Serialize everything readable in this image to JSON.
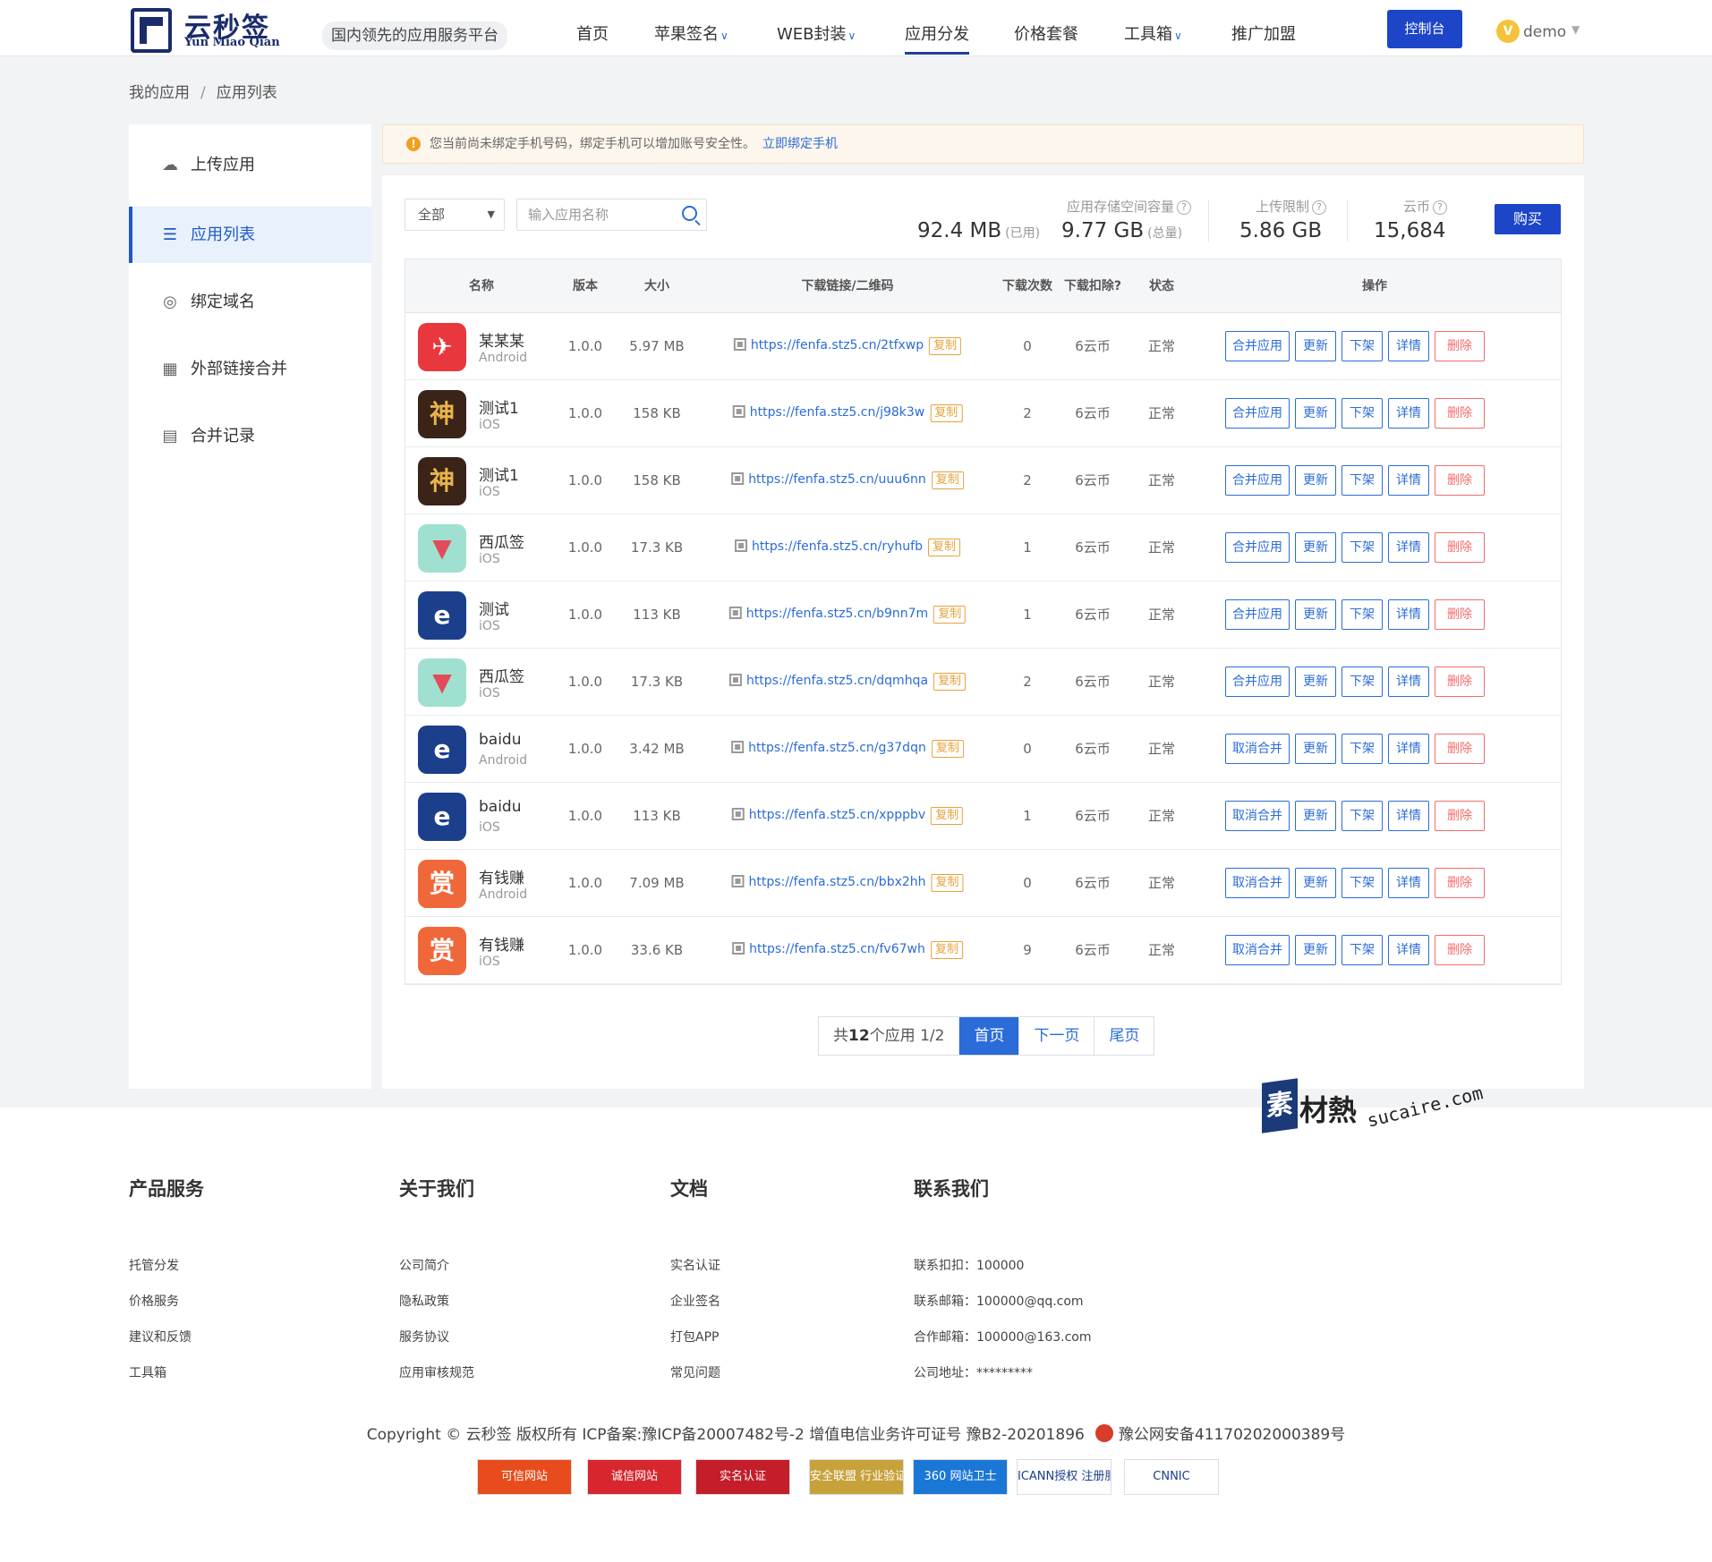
{
  "header": {
    "logo_cn": "云秒签",
    "logo_en": "Yun Miao Qian",
    "slogan": "国内领先的应用服务平台",
    "nav": [
      "首页",
      "苹果签名",
      "WEB封装",
      "应用分发",
      "价格套餐",
      "工具箱",
      "推广加盟"
    ],
    "console": "控制台",
    "user_initial": "V",
    "user": "demo"
  },
  "breadcrumb": [
    "我的应用",
    "应用列表"
  ],
  "sidebar": {
    "items": [
      {
        "icon": "cloud-upload-icon",
        "label": "上传应用"
      },
      {
        "icon": "list-icon",
        "label": "应用列表"
      },
      {
        "icon": "globe-icon",
        "label": "绑定域名"
      },
      {
        "icon": "qrcode-icon",
        "label": "外部链接合并"
      },
      {
        "icon": "clipboard-icon",
        "label": "合并记录"
      }
    ]
  },
  "notice": {
    "text": "您当前尚未绑定手机号码，绑定手机可以增加账号安全性。",
    "link": "立即绑定手机"
  },
  "filters": {
    "select_value": "全部",
    "search_placeholder": "输入应用名称"
  },
  "stats": {
    "storage_label": "应用存储空间容量",
    "used": "92.4 MB",
    "used_suffix": "(已用)",
    "total": "9.77 GB",
    "total_suffix": "(总量)",
    "upload_label": "上传限制",
    "upload": "5.86 GB",
    "coin_label": "云币",
    "coin": "15,684",
    "buy": "购买"
  },
  "table": {
    "headers": [
      "名称",
      "版本",
      "大小",
      "下载链接/二维码",
      "下载次数",
      "下载扣除?",
      "状态",
      "操作"
    ],
    "copy_label": "复制",
    "ops": [
      "更新",
      "下架",
      "详情",
      "删除"
    ],
    "rows": [
      {
        "name": "某某某",
        "platform": "Android",
        "icon": "red-app-icon",
        "version": "1.0.0",
        "size": "5.97 MB",
        "url": "https://fenfa.stz5.cn/2tfxwp",
        "downloads": "0",
        "cost": "6云币",
        "status": "正常",
        "merge": "合并应用"
      },
      {
        "name": "测试1",
        "platform": "iOS",
        "icon": "game-app-icon",
        "version": "1.0.0",
        "size": "158 KB",
        "url": "https://fenfa.stz5.cn/j98k3w",
        "downloads": "2",
        "cost": "6云币",
        "status": "正常",
        "merge": "合并应用"
      },
      {
        "name": "测试1",
        "platform": "iOS",
        "icon": "game-app-icon",
        "version": "1.0.0",
        "size": "158 KB",
        "url": "https://fenfa.stz5.cn/uuu6nn",
        "downloads": "2",
        "cost": "6云币",
        "status": "正常",
        "merge": "合并应用"
      },
      {
        "name": "西瓜签",
        "platform": "iOS",
        "icon": "watermelon-app-icon",
        "version": "1.0.0",
        "size": "17.3 KB",
        "url": "https://fenfa.stz5.cn/ryhufb",
        "downloads": "1",
        "cost": "6云币",
        "status": "正常",
        "merge": "合并应用"
      },
      {
        "name": "测试",
        "platform": "iOS",
        "icon": "telecom-app-icon",
        "version": "1.0.0",
        "size": "113 KB",
        "url": "https://fenfa.stz5.cn/b9nn7m",
        "downloads": "1",
        "cost": "6云币",
        "status": "正常",
        "merge": "合并应用"
      },
      {
        "name": "西瓜签",
        "platform": "iOS",
        "icon": "watermelon-app-icon",
        "version": "1.0.0",
        "size": "17.3 KB",
        "url": "https://fenfa.stz5.cn/dqmhqa",
        "downloads": "2",
        "cost": "6云币",
        "status": "正常",
        "merge": "合并应用"
      },
      {
        "name": "baidu",
        "platform": "Android",
        "icon": "telecom-app-icon",
        "version": "1.0.0",
        "size": "3.42 MB",
        "url": "https://fenfa.stz5.cn/g37dqn",
        "downloads": "0",
        "cost": "6云币",
        "status": "正常",
        "merge": "取消合并"
      },
      {
        "name": "baidu",
        "platform": "iOS",
        "icon": "telecom-app-icon",
        "version": "1.0.0",
        "size": "113 KB",
        "url": "https://fenfa.stz5.cn/xpppbv",
        "downloads": "1",
        "cost": "6云币",
        "status": "正常",
        "merge": "取消合并"
      },
      {
        "name": "有钱赚",
        "platform": "Android",
        "icon": "reward-app-icon",
        "version": "1.0.0",
        "size": "7.09 MB",
        "url": "https://fenfa.stz5.cn/bbx2hh",
        "downloads": "0",
        "cost": "6云币",
        "status": "正常",
        "merge": "取消合并"
      },
      {
        "name": "有钱赚",
        "platform": "iOS",
        "icon": "reward-app-icon",
        "version": "1.0.0",
        "size": "33.6 KB",
        "url": "https://fenfa.stz5.cn/fv67wh",
        "downloads": "9",
        "cost": "6云币",
        "status": "正常",
        "merge": "取消合并"
      }
    ]
  },
  "pagination": {
    "summary_prefix": "共",
    "summary_count": "12",
    "summary_suffix": "个应用 1/2",
    "first": "首页",
    "next": "下一页",
    "last": "尾页"
  },
  "watermark": {
    "char": "素",
    "cn": "材熱",
    "en": "sucaire.com"
  },
  "footer": {
    "columns": [
      {
        "title": "产品服务",
        "links": [
          "托管分发",
          "价格服务",
          "建议和反馈",
          "工具箱"
        ]
      },
      {
        "title": "关于我们",
        "links": [
          "公司简介",
          "隐私政策",
          "服务协议",
          "应用审核规范"
        ]
      },
      {
        "title": "文档",
        "links": [
          "实名认证",
          "企业签名",
          "打包APP",
          "常见问题"
        ]
      },
      {
        "title": "联系我们",
        "links": [
          "联系扣扣：100000",
          "联系邮箱：100000@qq.com",
          "合作邮箱：100000@163.com",
          "公司地址：*********"
        ]
      }
    ],
    "copyright": "Copyright © 云秒签 版权所有 ICP备案:豫ICP备20007482号-2 增值电信业务许可证号 豫B2-20201896",
    "police": "豫公网安备41170202000389号",
    "badges": [
      "可信网站",
      "诚信网站",
      "实名认证",
      "安全联盟 行业验证",
      "360 网站卫士",
      "ICANN授权 注册服务机构",
      "CNNIC"
    ]
  },
  "colors": {
    "primary": "#1c45c8",
    "link": "#2b6cd8",
    "danger": "#f56c6c",
    "warning": "#e6a23c"
  }
}
